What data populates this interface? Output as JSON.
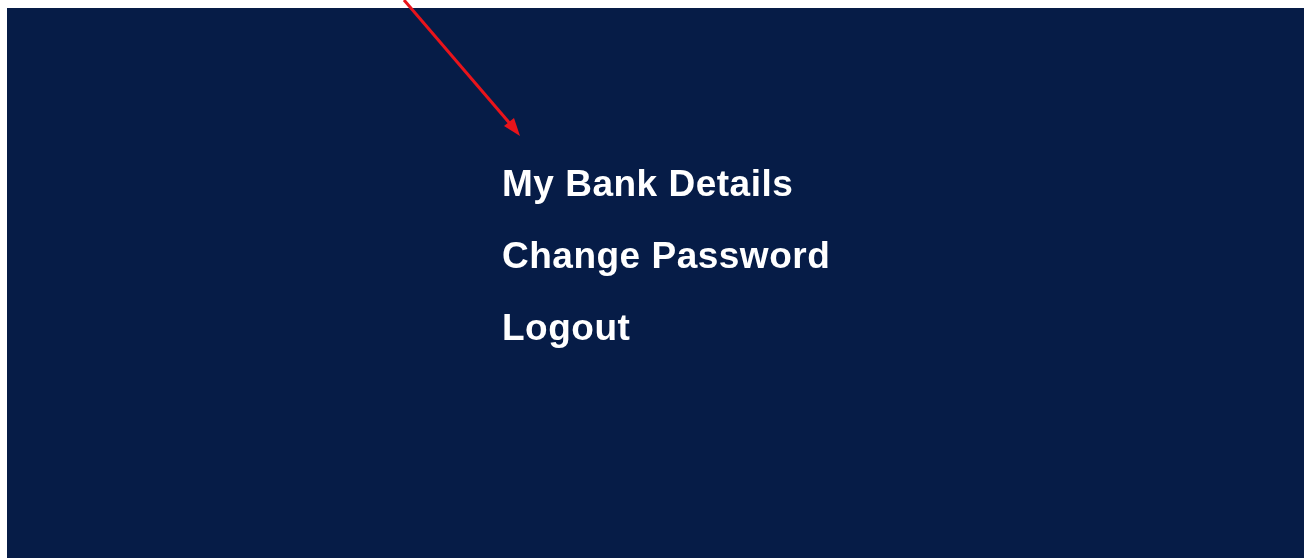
{
  "menu": {
    "items": [
      {
        "label": "My Bank Details"
      },
      {
        "label": "Change Password"
      },
      {
        "label": "Logout"
      }
    ]
  }
}
